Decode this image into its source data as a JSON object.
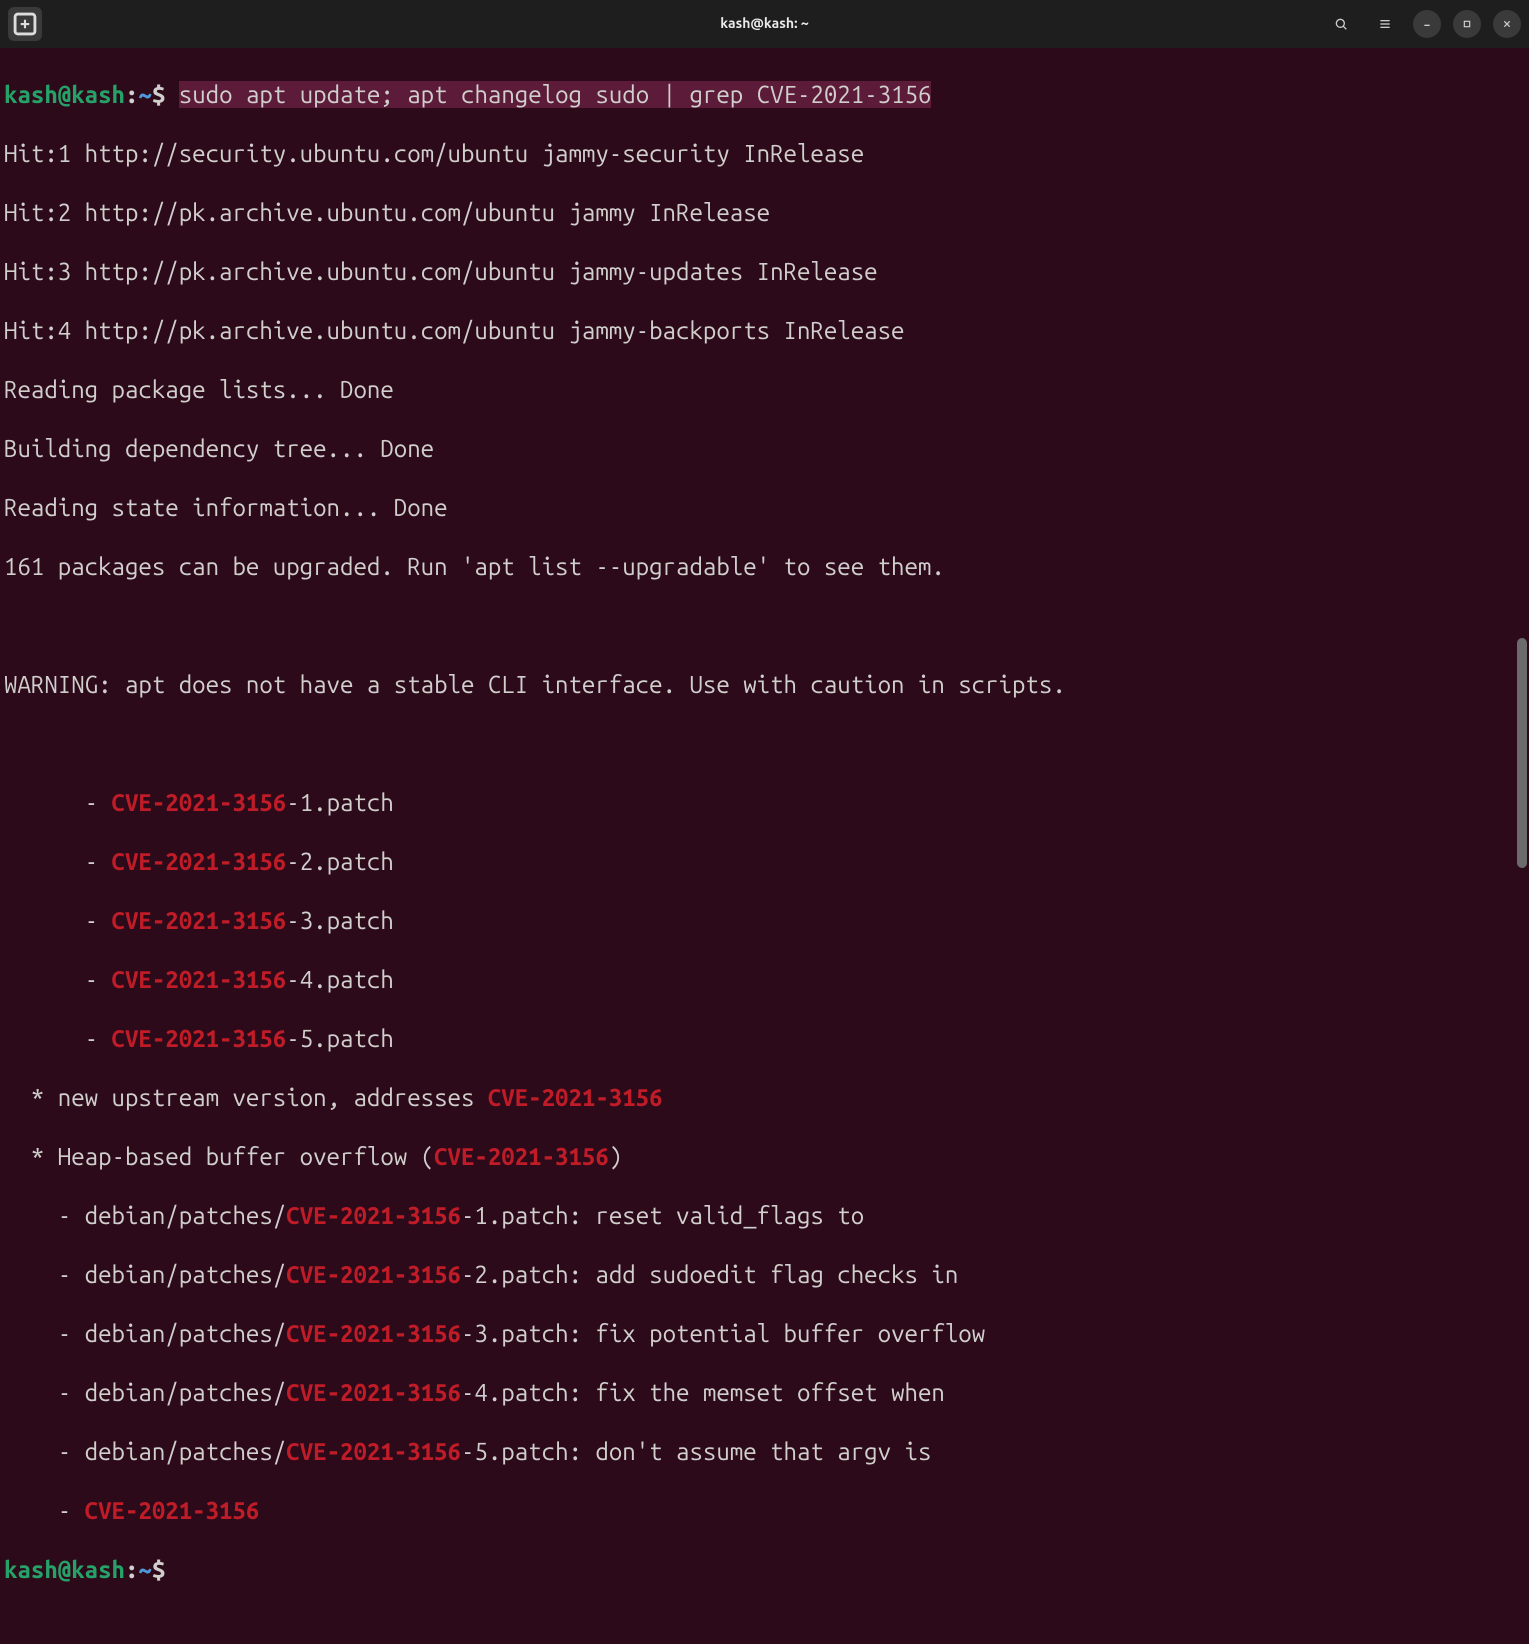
{
  "titlebar": {
    "title": "kash@kash: ~"
  },
  "prompt": {
    "user_host": "kash@kash",
    "colon": ":",
    "path": "~",
    "dollar": "$ "
  },
  "command": "sudo apt update; apt changelog sudo | grep CVE-2021-3156",
  "cve": "CVE-2021-3156",
  "output": {
    "hit1": "Hit:1 http://security.ubuntu.com/ubuntu jammy-security InRelease",
    "hit2": "Hit:2 http://pk.archive.ubuntu.com/ubuntu jammy InRelease",
    "hit3": "Hit:3 http://pk.archive.ubuntu.com/ubuntu jammy-updates InRelease",
    "hit4": "Hit:4 http://pk.archive.ubuntu.com/ubuntu jammy-backports InRelease",
    "reading_lists": "Reading package lists... Done",
    "building_tree": "Building dependency tree... Done",
    "reading_state": "Reading state information... Done",
    "upgradable": "161 packages can be upgraded. Run 'apt list --upgradable' to see them.",
    "warning": "WARNING: apt does not have a stable CLI interface. Use with caution in scripts.",
    "bullet_prefix": "      - ",
    "patch1_suffix": "-1.patch",
    "patch2_suffix": "-2.patch",
    "patch3_suffix": "-3.patch",
    "patch4_suffix": "-4.patch",
    "patch5_suffix": "-5.patch",
    "upstream_pre": "  * new upstream version, addresses ",
    "heap_pre": "  * Heap-based buffer overflow (",
    "heap_post": ")",
    "dp_prefix": "    - debian/patches/",
    "dp1_post": "-1.patch: reset valid_flags to",
    "dp2_post": "-2.patch: add sudoedit flag checks in",
    "dp3_post": "-3.patch: fix potential buffer overflow",
    "dp4_post": "-4.patch: fix the memset offset when",
    "dp5_post": "-5.patch: don't assume that argv is",
    "final_prefix": "    - "
  }
}
